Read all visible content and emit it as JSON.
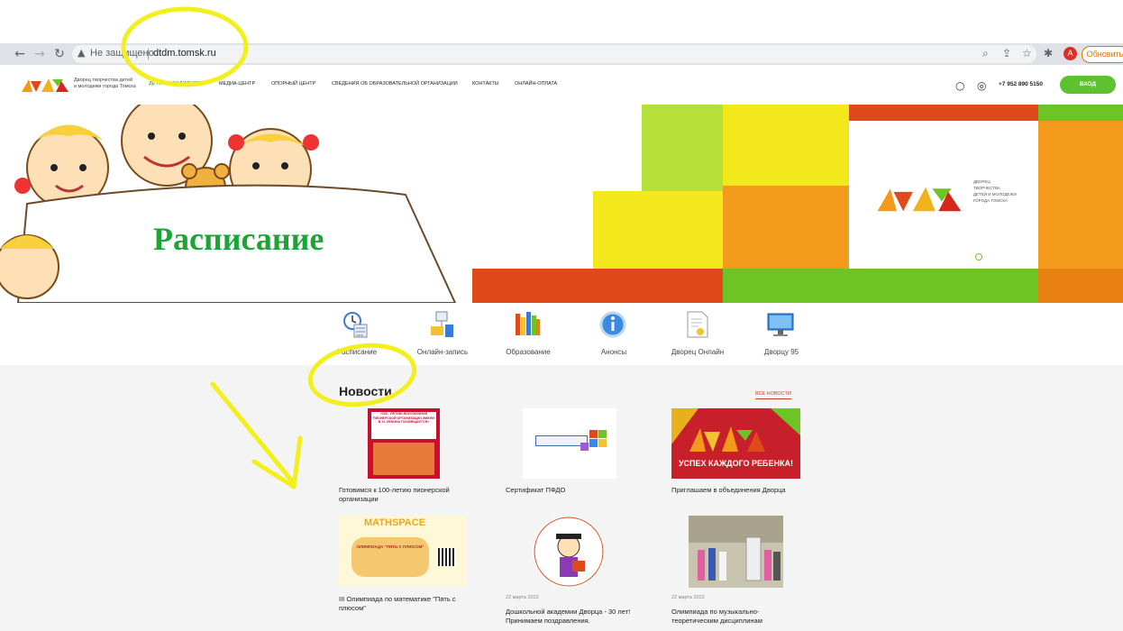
{
  "browser": {
    "insecure_label": "Не защищено",
    "url": "dtdm.tomsk.ru",
    "update_label": "Обновить",
    "avatar_letter": "A"
  },
  "site": {
    "logo_text_line1": "Дворец творчества детей",
    "logo_text_line2": "и молодежи города Томска",
    "menu": [
      {
        "label": "ДЕТЯМ И РОДИТЕЛЯМ"
      },
      {
        "label": "МЕДИА-ЦЕНТР"
      },
      {
        "label": "ОПОРНЫЙ ЦЕНТР"
      },
      {
        "label": "СВЕДЕНИЯ ОБ ОБРАЗОВАТЕЛЬНОЙ ОРГАНИЗАЦИИ"
      },
      {
        "label": "КОНТАКТЫ"
      },
      {
        "label": "ОНЛАЙН-ОПЛАТА"
      }
    ],
    "phone": "+7 952 890 5150",
    "login_label": "ВХОД"
  },
  "hero": {
    "title": "Расписание",
    "brand_caption_lines": [
      "ДВОРЕЦ",
      "ТВОРЧЕСТВА",
      "ДЕТЕЙ И МОЛОДЕЖИ",
      "ГОРОДА ТОМСКА"
    ],
    "colors": {
      "green": "#6ec425",
      "lime": "#b5e03a",
      "yellow": "#f2e81c",
      "orange": "#f39a1c",
      "red": "#e04a1a",
      "dark_orange": "#e88012"
    }
  },
  "tiles": [
    {
      "label": "Расписание",
      "icon": "schedule-icon"
    },
    {
      "label": "Онлайн-запись",
      "icon": "online-signup-icon"
    },
    {
      "label": "Образование",
      "icon": "education-icon"
    },
    {
      "label": "Анонсы",
      "icon": "info-icon"
    },
    {
      "label": "Дворец Онлайн",
      "icon": "document-icon"
    },
    {
      "label": "Дворцу 95",
      "icon": "monitor-icon"
    }
  ],
  "news": {
    "title": "Новости",
    "all_label": "ВСЕ НОВОСТИ",
    "cards": [
      {
        "caption": "Готовимся к 100-летию пионерской организации",
        "date": "",
        "img_text": "«100 - ЛЕТИЮ ВСЕСОЮЗНОЙ ПИОНЕРСКОЙ ОРГАНИЗАЦИИ ИМЕНИ В. И. ЛЕНИНА ПОСВЯЩАЕТСЯ»"
      },
      {
        "caption": "Сертификат ПФДО",
        "date": "",
        "img_text": ""
      },
      {
        "caption": "Приглашаем в объединения Дворца",
        "date": "",
        "img_text": "УСПЕХ КАЖДОГО РЕБЕНКА!"
      },
      {
        "caption": "III Олимпиада по математике \"Пять с плюсом\"",
        "date": "",
        "img_text": "MATHSPACE",
        "img_text2": "ОЛИМПИАДА \"ПЯТЬ С ПЛЮСОМ\""
      },
      {
        "caption": "Дошкольной академии Дворца - 30 лет! Принимаем поздравления.",
        "date": "22 марта 2022",
        "img_text": ""
      },
      {
        "caption": "Олимпиада по музыкально-теоретическим дисциплинам",
        "date": "22 марта 2022",
        "img_text": ""
      }
    ]
  },
  "annotation": {
    "highlight_color": "#f3ef1f"
  }
}
